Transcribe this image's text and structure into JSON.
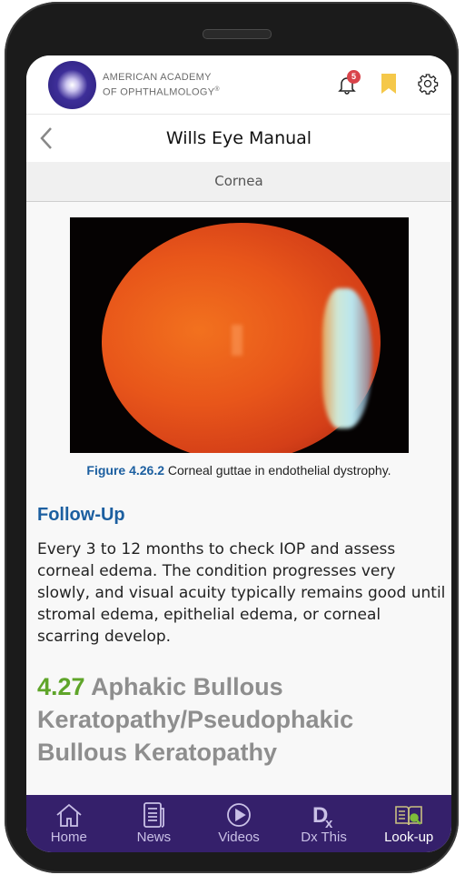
{
  "header": {
    "logo_line1": "AMERICAN ACADEMY",
    "logo_line2": "OF OPHTHALMOLOGY",
    "logo_mark": "®",
    "notification_count": "5",
    "icons": [
      "bell-icon",
      "bookmark-icon",
      "gear-icon"
    ],
    "bookmark_color": "#f5c84a",
    "badge_color": "#d9434a"
  },
  "nav": {
    "title": "Wills Eye Manual",
    "back_icon": "chevron-left-icon"
  },
  "section": {
    "label": "Cornea"
  },
  "figure": {
    "number": "Figure 4.26.2",
    "caption": "Corneal guttae in endothelial dystrophy."
  },
  "content": {
    "heading": "Follow-Up",
    "paragraph": "Every 3 to 12 months to check IOP and assess corneal edema. The condition progresses very slowly, and visual acuity typically remains good until stromal edema, epithelial edema, or corneal scarring develop.",
    "next_section_number": "4.27",
    "next_section_title": "Aphakic Bullous Keratopathy/Pseudophakic Bullous Keratopathy"
  },
  "colors": {
    "accent_blue": "#1c5fa0",
    "accent_green": "#5fa52a",
    "tabbar_bg": "#35206b"
  },
  "tabbar": {
    "items": [
      {
        "label": "Home",
        "icon": "home-icon"
      },
      {
        "label": "News",
        "icon": "news-icon"
      },
      {
        "label": "Videos",
        "icon": "play-circle-icon"
      },
      {
        "label": "Dx This",
        "icon": "dx-icon"
      },
      {
        "label": "Look-up",
        "icon": "book-search-icon",
        "active": true
      }
    ]
  }
}
